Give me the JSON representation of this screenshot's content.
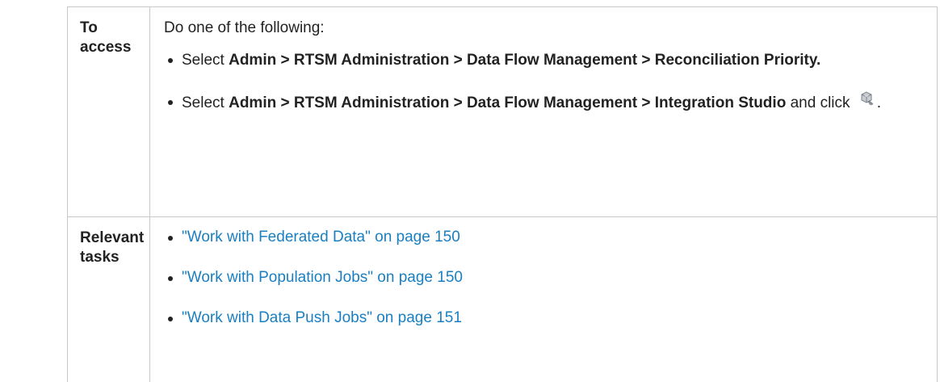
{
  "access": {
    "label": "To access",
    "intro": "Do one of the following:",
    "item1": {
      "prefix": "Select ",
      "bold": "Admin > RTSM Administration > Data Flow Management > Reconciliation Priority."
    },
    "item2": {
      "prefix": "Select ",
      "bold": "Admin > RTSM Administration > Data Flow Management > Integration Studio",
      "suffix": " and click ",
      "end": ".",
      "icon": "integration-studio-icon"
    }
  },
  "tasks": {
    "label": "Relevant tasks",
    "links": [
      "\"Work with Federated Data\" on page 150",
      "\"Work with Population Jobs\" on page 150",
      "\"Work with Data Push Jobs\" on page 151"
    ]
  },
  "colors": {
    "link": "#1a7fc1",
    "border": "#c8c8c8",
    "text": "#222222"
  }
}
